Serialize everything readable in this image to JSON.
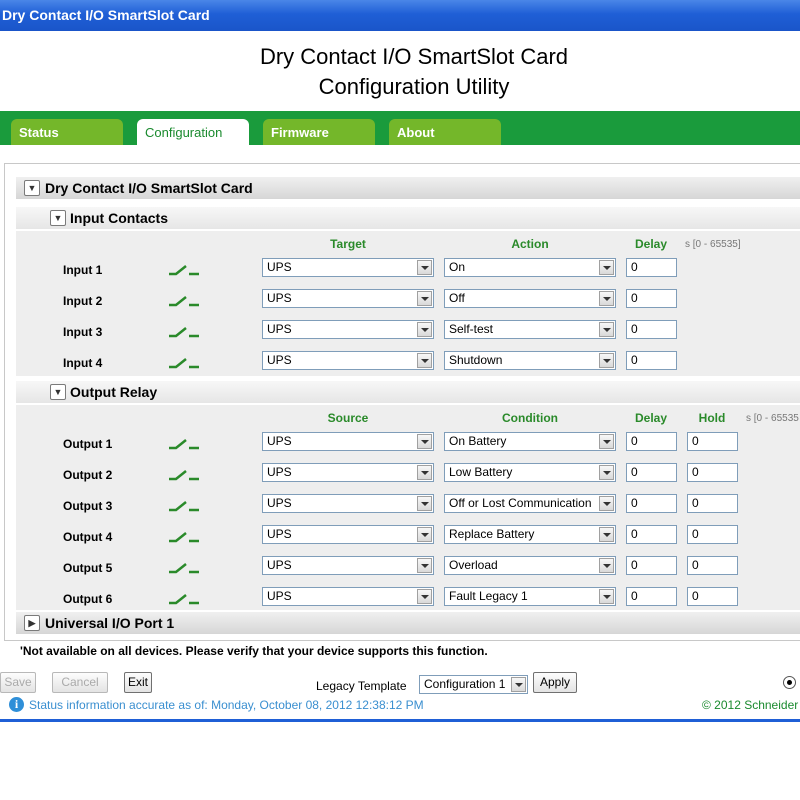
{
  "window_title": "Dry Contact I/O SmartSlot Card",
  "heading": {
    "line1": "Dry Contact I/O SmartSlot Card",
    "line2": "Configuration Utility"
  },
  "tabs": [
    {
      "label": "Status"
    },
    {
      "label": "Configuration"
    },
    {
      "label": "Firmware"
    },
    {
      "label": "About"
    }
  ],
  "main_section": {
    "title": "Dry Contact I/O SmartSlot Card"
  },
  "input_contacts": {
    "title": "Input Contacts",
    "headers": {
      "target": "Target",
      "action": "Action",
      "delay": "Delay"
    },
    "range": "s [0 - 65535]",
    "rows": [
      {
        "label": "Input 1",
        "target": "UPS",
        "action": "On",
        "delay": "0"
      },
      {
        "label": "Input 2",
        "target": "UPS",
        "action": "Off",
        "delay": "0"
      },
      {
        "label": "Input 3",
        "target": "UPS",
        "action": "Self-test",
        "delay": "0"
      },
      {
        "label": "Input 4",
        "target": "UPS",
        "action": "Shutdown",
        "delay": "0"
      }
    ]
  },
  "output_relay": {
    "title": "Output Relay",
    "headers": {
      "source": "Source",
      "condition": "Condition",
      "delay": "Delay",
      "hold": "Hold"
    },
    "range": "s [0 - 65535",
    "rows": [
      {
        "label": "Output 1",
        "source": "UPS",
        "condition": "On Battery",
        "delay": "0",
        "hold": "0"
      },
      {
        "label": "Output 2",
        "source": "UPS",
        "condition": "Low Battery",
        "delay": "0",
        "hold": "0"
      },
      {
        "label": "Output 3",
        "source": "UPS",
        "condition": "Off or Lost Communication",
        "delay": "0",
        "hold": "0"
      },
      {
        "label": "Output 4",
        "source": "UPS",
        "condition": "Replace Battery",
        "delay": "0",
        "hold": "0"
      },
      {
        "label": "Output 5",
        "source": "UPS",
        "condition": "Overload",
        "delay": "0",
        "hold": "0"
      },
      {
        "label": "Output 6",
        "source": "UPS",
        "condition": "Fault Legacy 1",
        "delay": "0",
        "hold": "0"
      }
    ]
  },
  "universal_port": {
    "title": "Universal I/O Port 1"
  },
  "note": "'Not available on all devices. Please verify that your device supports this function.",
  "buttons": {
    "save": "Save",
    "cancel": "Cancel",
    "exit": "Exit",
    "apply": "Apply"
  },
  "legacy_template": {
    "label": "Legacy Template",
    "value": "Configuration 1"
  },
  "status": {
    "text": "Status information accurate as of: Monday, October 08, 2012 12:38:12 PM",
    "copyright": "© 2012 Schneider"
  },
  "colors": {
    "title_blue": "#1f5fd6",
    "tab_green": "#74b72a",
    "bar_green": "#1a9b3c",
    "header_green": "#2a8a2a"
  },
  "icons": {
    "switch": "switch-icon",
    "info": "info-icon",
    "collapse": "collapse-icon",
    "expand": "expand-icon"
  }
}
